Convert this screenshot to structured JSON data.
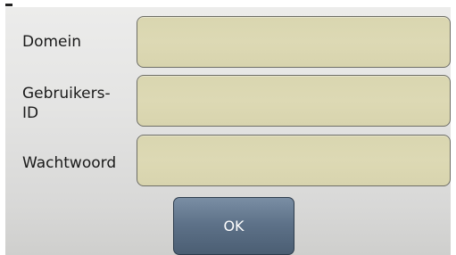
{
  "form": {
    "domain": {
      "label": "Domein",
      "value": ""
    },
    "user_id": {
      "label_line1": "Gebruikers-",
      "label_line2": "ID",
      "value": ""
    },
    "password": {
      "label": "Wachtwoord",
      "value": ""
    },
    "ok_label": "OK"
  },
  "colors": {
    "field_fill": "#dbd8b2",
    "button_fill": "#5e7289",
    "background": "#e2e2e1"
  }
}
